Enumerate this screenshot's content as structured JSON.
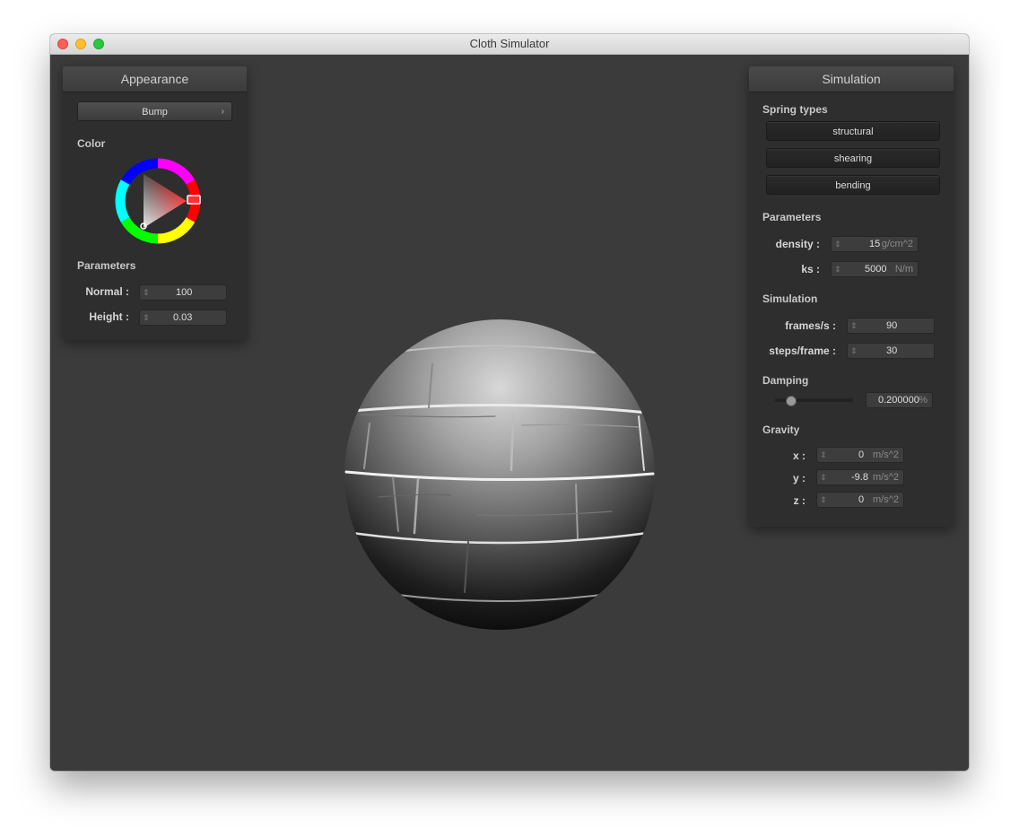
{
  "window": {
    "title": "Cloth Simulator"
  },
  "appearance": {
    "header": "Appearance",
    "shader_select": {
      "value": "Bump",
      "chevron": "chevron-right-icon"
    },
    "color_label": "Color",
    "color_wheel": {
      "hue_color": "#ff2020"
    },
    "params_label": "Parameters",
    "normal": {
      "label": "Normal :",
      "value": "100"
    },
    "height": {
      "label": "Height :",
      "value": "0.03"
    }
  },
  "simulation": {
    "header": "Simulation",
    "spring_types_label": "Spring types",
    "spring_buttons": [
      "structural",
      "shearing",
      "bending"
    ],
    "params_label": "Parameters",
    "density": {
      "label": "density :",
      "value": "15",
      "unit": "g/cm^2"
    },
    "ks": {
      "label": "ks :",
      "value": "5000",
      "unit": "N/m"
    },
    "sim_label": "Simulation",
    "fps": {
      "label": "frames/s :",
      "value": "90"
    },
    "steps": {
      "label": "steps/frame :",
      "value": "30"
    },
    "damping_label": "Damping",
    "damping": {
      "value": "0.200000",
      "unit": "%",
      "slider_fraction": 0.2
    },
    "gravity_label": "Gravity",
    "gx": {
      "label": "x :",
      "value": "0",
      "unit": "m/s^2"
    },
    "gy": {
      "label": "y :",
      "value": "-9.8",
      "unit": "m/s^2"
    },
    "gz": {
      "label": "z :",
      "value": "0",
      "unit": "m/s^2"
    }
  }
}
